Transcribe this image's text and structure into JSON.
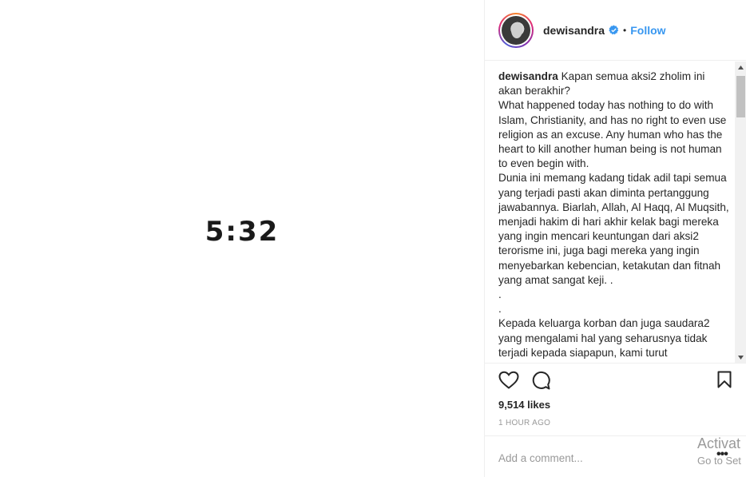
{
  "media": {
    "overlay_text": "5:32"
  },
  "post_header": {
    "username": "dewisandra",
    "separator": "•",
    "follow_label": "Follow",
    "verified_icon": "verified-badge-icon",
    "accent_color": "#3897f0"
  },
  "caption": {
    "username": "dewisandra",
    "text": " Kapan semua aksi2 zholim ini akan berakhir?\nWhat happened today has nothing to do with Islam, Christianity, and has no right to even use religion as an excuse. Any human who has the heart to kill another human being is not human to even begin with.\nDunia ini memang kadang tidak adil tapi semua yang terjadi pasti akan diminta pertanggung jawabannya. Biarlah, Allah, Al Haqq, Al Muqsith, menjadi hakim di hari akhir kelak bagi mereka yang ingin mencari keuntungan dari aksi2 terorisme ini, juga bagi mereka yang ingin menyebarkan kebencian, ketakutan dan fitnah yang amat sangat keji. .\n.\n.\nKepada keluarga korban dan juga saudara2 yang mengalami hal yang seharusnya tidak terjadi kepada siapapun, kami turut"
  },
  "actions": {
    "like_icon": "heart-icon",
    "comment_icon": "comment-icon",
    "save_icon": "bookmark-icon"
  },
  "stats": {
    "likes": "9,514 likes",
    "timestamp": "1 HOUR AGO"
  },
  "comment_form": {
    "placeholder": "Add a comment...",
    "more_label": "•••"
  },
  "watermark": {
    "title": "Activat",
    "subtitle": "Go to Set"
  }
}
